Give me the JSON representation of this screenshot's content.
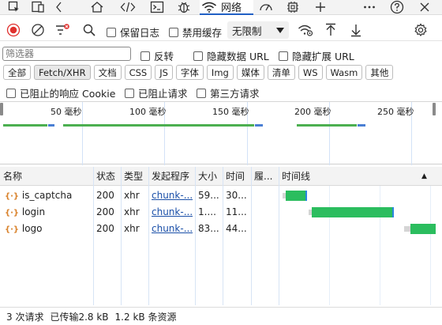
{
  "tabs": {
    "network_label": "网络",
    "icons": [
      "inspect-icon",
      "device-emulation-icon",
      "welcome-home-icon",
      "elements-icon",
      "console-icon",
      "sources-icon",
      "network-icon",
      "performance-icon",
      "memory-icon",
      "add-tool-icon",
      "more-tools-icon",
      "help-icon",
      "close-icon"
    ]
  },
  "toolbar": {
    "preserve_log_label": "保留日志",
    "disable_cache_label": "禁用缓存",
    "throttle_value": "无限制"
  },
  "filter": {
    "placeholder": "筛选器",
    "invert_label": "反转",
    "hide_data_url_label": "隐藏数据 URL",
    "hide_ext_url_label": "隐藏扩展 URL"
  },
  "type_filters": [
    "全部",
    "Fetch/XHR",
    "文档",
    "CSS",
    "JS",
    "字体",
    "Img",
    "媒体",
    "清单",
    "WS",
    "Wasm",
    "其他"
  ],
  "active_type_filter": "Fetch/XHR",
  "row3": {
    "blocked_cookie_label": "已阻止的响应 Cookie",
    "blocked_requests_label": "已阻止请求",
    "third_party_label": "第三方请求"
  },
  "overview": {
    "ticks": [
      "50 毫秒",
      "100 毫秒",
      "150 毫秒",
      "200 毫秒",
      "250 毫秒"
    ]
  },
  "table": {
    "columns": [
      "名称",
      "状态",
      "类型",
      "发起程序",
      "大小",
      "时间",
      "履...",
      "时间线"
    ],
    "sort_indicator": "▲",
    "rows": [
      {
        "name": "is_captcha",
        "status": "200",
        "type": "xhr",
        "initiator": "chunk-...",
        "size": "59...",
        "time": "30..."
      },
      {
        "name": "login",
        "status": "200",
        "type": "xhr",
        "initiator": "chunk-...",
        "size": "1....",
        "time": "11..."
      },
      {
        "name": "logo",
        "status": "200",
        "type": "xhr",
        "initiator": "chunk-...",
        "size": "83...",
        "time": "44..."
      }
    ]
  },
  "status": {
    "requests": "3 次请求",
    "transferred": "已传输2.8 kB",
    "resources": "1.2 kB 条资源"
  },
  "colors": {
    "accent": "#2160c4",
    "record_red": "#e0302d",
    "waterfall_green": "#2bbd5e"
  }
}
